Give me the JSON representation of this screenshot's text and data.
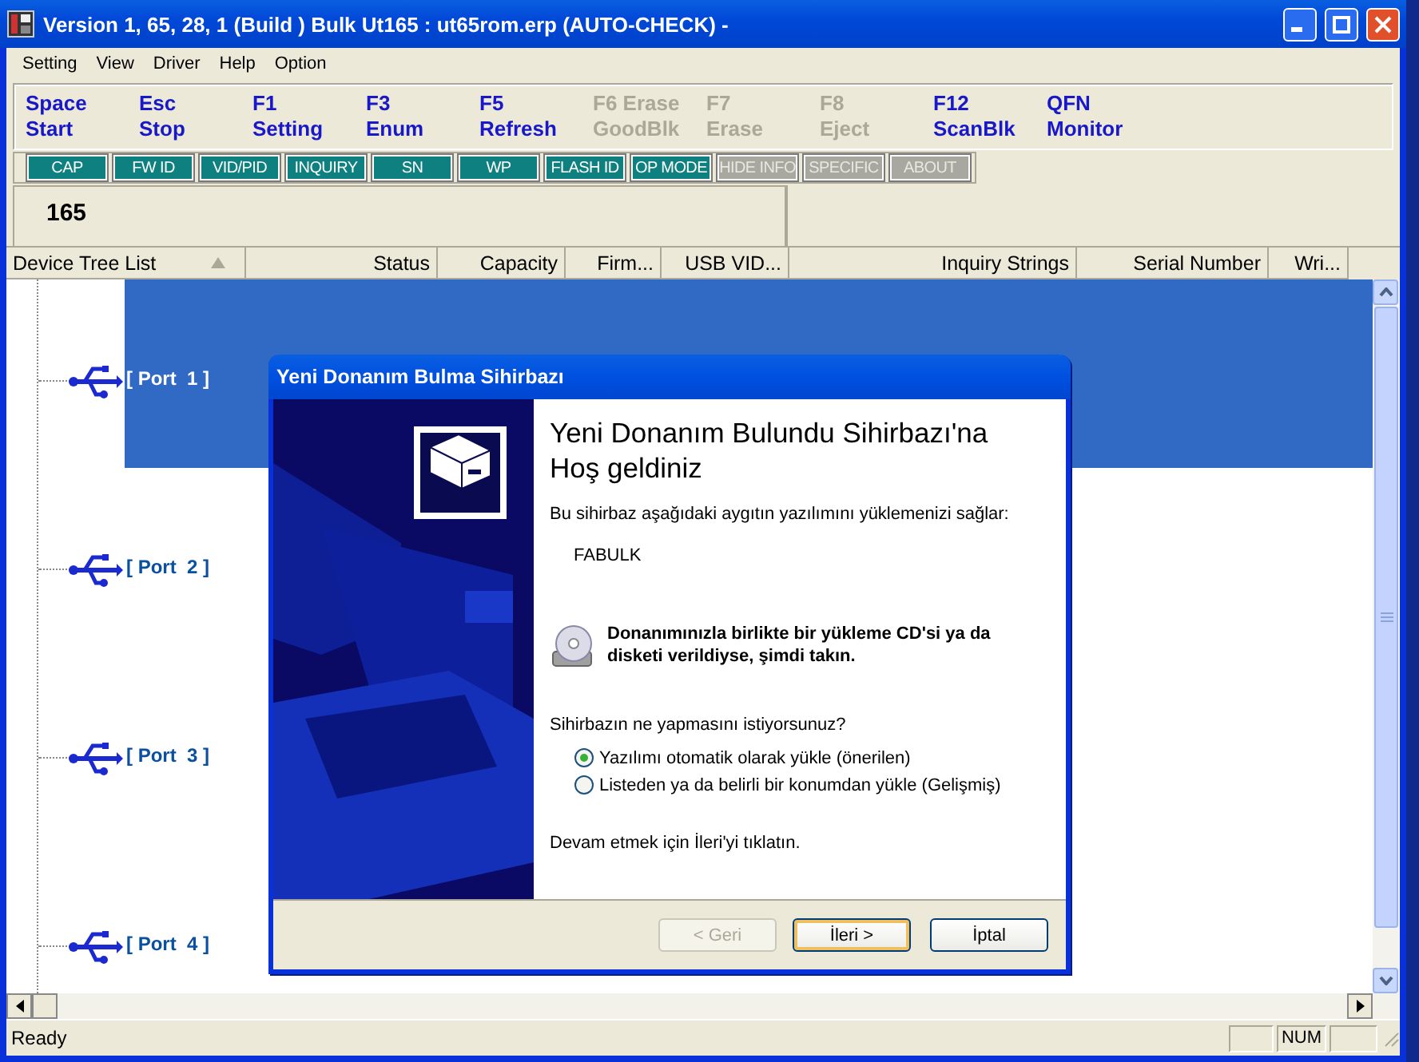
{
  "window": {
    "title": "Version 1, 65, 28, 1 (Build )  Bulk Ut165 : ut65rom.erp  (AUTO-CHECK) -"
  },
  "menu": [
    "Setting",
    "View",
    "Driver",
    "Help",
    "Option"
  ],
  "hotkeys": [
    {
      "key": "Space",
      "label": "Start",
      "disabled": false
    },
    {
      "key": "Esc",
      "label": "Stop",
      "disabled": false
    },
    {
      "key": "F1",
      "label": "Setting",
      "disabled": false
    },
    {
      "key": "F3",
      "label": "Enum",
      "disabled": false
    },
    {
      "key": "F5",
      "label": "Refresh",
      "disabled": false
    },
    {
      "key": "F6 Erase",
      "label": "GoodBlk",
      "disabled": true
    },
    {
      "key": "F7",
      "label": "Erase",
      "disabled": true
    },
    {
      "key": "F8",
      "label": "Eject",
      "disabled": true
    },
    {
      "key": "F12",
      "label": "ScanBlk",
      "disabled": false
    },
    {
      "key": "QFN",
      "label": "Monitor",
      "disabled": false
    }
  ],
  "tool_buttons": [
    {
      "label": "CAP",
      "disabled": false
    },
    {
      "label": "FW ID",
      "disabled": false
    },
    {
      "label": "VID/PID",
      "disabled": false
    },
    {
      "label": "INQUIRY",
      "disabled": false
    },
    {
      "label": "SN",
      "disabled": false
    },
    {
      "label": "WP",
      "disabled": false
    },
    {
      "label": "FLASH ID",
      "disabled": false
    },
    {
      "label": "OP MODE",
      "disabled": false
    },
    {
      "label": "HIDE INFO",
      "disabled": true
    },
    {
      "label": "SPECIFIC",
      "disabled": true
    },
    {
      "label": "ABOUT",
      "disabled": true
    }
  ],
  "info": {
    "count": "165"
  },
  "table": {
    "columns": [
      {
        "label": "Device Tree List",
        "sorted": true
      },
      {
        "label": "Status",
        "sorted": false
      },
      {
        "label": "Capacity",
        "sorted": false
      },
      {
        "label": "Firm...",
        "sorted": false
      },
      {
        "label": "USB VID...",
        "sorted": false
      },
      {
        "label": "Inquiry Strings",
        "sorted": false
      },
      {
        "label": "Serial Number",
        "sorted": false
      },
      {
        "label": "Wri...",
        "sorted": false
      }
    ]
  },
  "tree": {
    "items": [
      {
        "label": "[ Port  1 ]",
        "selected": true
      },
      {
        "label": "[ Port  2 ]",
        "selected": false
      },
      {
        "label": "[ Port  3 ]",
        "selected": false
      },
      {
        "label": "[ Port  4 ]",
        "selected": false
      }
    ]
  },
  "status_bar": {
    "text": "Ready",
    "num_indicator": "NUM"
  },
  "dialog": {
    "title": "Yeni Donanım Bulma Sihirbazı",
    "heading": "Yeni Donanım Bulundu Sihirbazı'na Hoş geldiniz",
    "intro": "Bu sihirbaz aşağıdaki aygıtın yazılımını yüklemenizi sağlar:",
    "device": "FABULK",
    "cd_note": "Donanımınızla birlikte bir yükleme CD'si ya da disketi verildiyse, şimdi takın.",
    "question": "Sihirbazın ne yapmasını istiyorsunuz?",
    "options": [
      {
        "label": "Yazılımı otomatik olarak yükle (önerilen)",
        "selected": true
      },
      {
        "label": "Listeden ya da belirli bir konumdan yükle (Gelişmiş)",
        "selected": false
      }
    ],
    "footer_note": "Devam etmek için İleri'yi tıklatın.",
    "buttons": [
      {
        "label": "< Geri",
        "disabled": true,
        "default": false
      },
      {
        "label": "İleri >",
        "disabled": false,
        "default": true
      },
      {
        "label": "İptal",
        "disabled": false,
        "default": false
      }
    ]
  }
}
